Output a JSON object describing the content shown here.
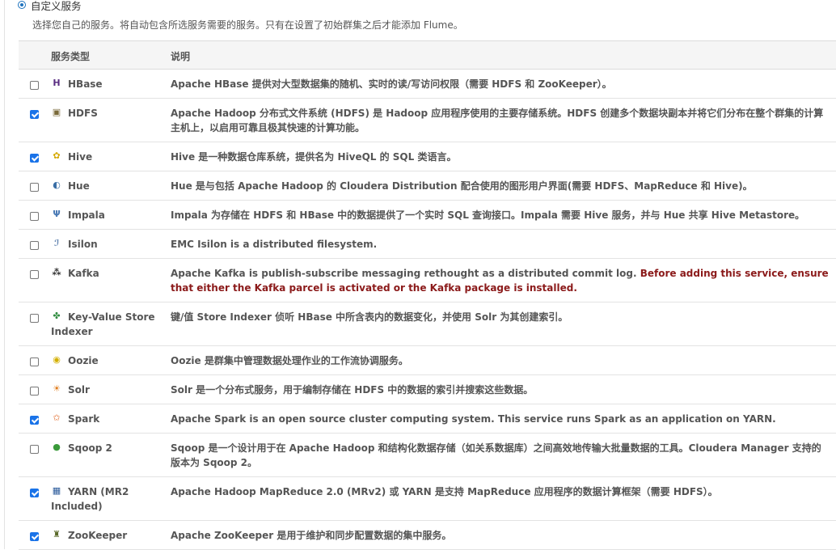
{
  "option": {
    "label": "自定义服务",
    "description": "选择您自己的服务。将自动包含所选服务需要的服务。只有在设置了初始群集之后才能添加 Flume。"
  },
  "table": {
    "headers": {
      "type": "服务类型",
      "description": "说明"
    },
    "rows": [
      {
        "name": "HBase",
        "checked": false,
        "icon": "hbase-icon",
        "glyph": "H",
        "color": "#5a2d82",
        "desc": "Apache HBase 提供对大型数据集的随机、实时的读/写访问权限（需要 HDFS 和 ZooKeeper）。",
        "warning": ""
      },
      {
        "name": "HDFS",
        "checked": true,
        "icon": "hdfs-icon",
        "glyph": "▣",
        "color": "#7a6a3a",
        "desc": "Apache Hadoop 分布式文件系统 (HDFS) 是 Hadoop 应用程序使用的主要存储系统。HDFS 创建多个数据块副本并将它们分布在整个群集的计算主机上，以启用可靠且极其快速的计算功能。",
        "warning": ""
      },
      {
        "name": "Hive",
        "checked": true,
        "icon": "hive-icon",
        "glyph": "✿",
        "color": "#d4a800",
        "desc": "Hive 是一种数据仓库系统，提供名为 HiveQL 的 SQL 类语言。",
        "warning": ""
      },
      {
        "name": "Hue",
        "checked": false,
        "icon": "hue-icon",
        "glyph": "◐",
        "color": "#3a6ea5",
        "desc": "Hue 是与包括 Apache Hadoop 的 Cloudera Distribution 配合使用的图形用户界面(需要 HDFS、MapReduce 和 Hive)。",
        "warning": ""
      },
      {
        "name": "Impala",
        "checked": false,
        "icon": "impala-icon",
        "glyph": "Ψ",
        "color": "#4a7ab5",
        "desc": "Impala 为存储在 HDFS 和 HBase 中的数据提供了一个实时 SQL 查询接口。Impala 需要 Hive 服务，并与 Hue 共享 Hive Metastore。",
        "warning": ""
      },
      {
        "name": "Isilon",
        "checked": false,
        "icon": "isilon-icon",
        "glyph": "ℐ",
        "color": "#6a8ab5",
        "desc": "EMC Isilon is a distributed filesystem.",
        "warning": ""
      },
      {
        "name": "Kafka",
        "checked": false,
        "icon": "kafka-icon",
        "glyph": "⁂",
        "color": "#333333",
        "desc": "Apache Kafka is publish-subscribe messaging rethought as a distributed commit log. ",
        "warning": "Before adding this service, ensure that either the Kafka parcel is activated or the Kafka package is installed."
      },
      {
        "name": "Key-Value Store Indexer",
        "checked": false,
        "icon": "key-value-store-icon",
        "glyph": "✤",
        "color": "#2e8b3e",
        "desc": "键/值 Store Indexer 侦听 HBase 中所含表内的数据变化，并使用 Solr 为其创建索引。",
        "warning": ""
      },
      {
        "name": "Oozie",
        "checked": false,
        "icon": "oozie-icon",
        "glyph": "◉",
        "color": "#d4b000",
        "desc": "Oozie 是群集中管理数据处理作业的工作流协调服务。",
        "warning": ""
      },
      {
        "name": "Solr",
        "checked": false,
        "icon": "solr-icon",
        "glyph": "☀",
        "color": "#e07b1a",
        "desc": "Solr 是一个分布式服务，用于编制存储在 HDFS 中的数据的索引并搜索这些数据。",
        "warning": ""
      },
      {
        "name": "Spark",
        "checked": true,
        "icon": "spark-icon",
        "glyph": "✩",
        "color": "#e0601a",
        "desc": "Apache Spark is an open source cluster computing system. This service runs Spark as an application on YARN.",
        "warning": ""
      },
      {
        "name": "Sqoop 2",
        "checked": false,
        "icon": "sqoop-icon",
        "glyph": "●",
        "color": "#3a9a3a",
        "desc": "Sqoop 是一个设计用于在 Apache Hadoop 和结构化数据存储（如关系数据库）之间高效地传输大批量数据的工具。Cloudera Manager 支持的版本为 Sqoop 2。",
        "warning": ""
      },
      {
        "name": "YARN (MR2 Included)",
        "checked": true,
        "icon": "yarn-icon",
        "glyph": "▦",
        "color": "#2a5a9a",
        "desc": "Apache Hadoop MapReduce 2.0 (MRv2) 或 YARN 是支持 MapReduce 应用程序的数据计算框架（需要 HDFS）。",
        "warning": ""
      },
      {
        "name": "ZooKeeper",
        "checked": true,
        "icon": "zookeeper-icon",
        "glyph": "♜",
        "color": "#5a6a2a",
        "desc": "Apache ZooKeeper 是用于维护和同步配置数据的集中服务。",
        "warning": ""
      }
    ]
  }
}
